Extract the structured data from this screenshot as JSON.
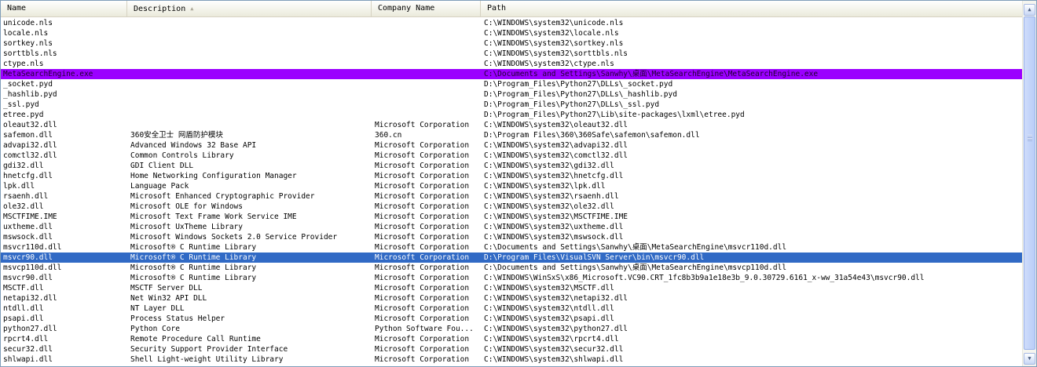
{
  "columns": {
    "name": "Name",
    "description": "Description",
    "company": "Company Name",
    "path": "Path"
  },
  "rows": [
    {
      "name": "unicode.nls",
      "description": "",
      "company": "",
      "path": "C:\\WINDOWS\\system32\\unicode.nls",
      "state": ""
    },
    {
      "name": "locale.nls",
      "description": "",
      "company": "",
      "path": "C:\\WINDOWS\\system32\\locale.nls",
      "state": ""
    },
    {
      "name": "sortkey.nls",
      "description": "",
      "company": "",
      "path": "C:\\WINDOWS\\system32\\sortkey.nls",
      "state": ""
    },
    {
      "name": "sorttbls.nls",
      "description": "",
      "company": "",
      "path": "C:\\WINDOWS\\system32\\sorttbls.nls",
      "state": ""
    },
    {
      "name": "ctype.nls",
      "description": "",
      "company": "",
      "path": "C:\\WINDOWS\\system32\\ctype.nls",
      "state": ""
    },
    {
      "name": "MetaSearchEngine.exe",
      "description": "",
      "company": "",
      "path": "C:\\Documents and Settings\\Sanwhy\\桌面\\MetaSearchEngine\\MetaSearchEngine.exe",
      "state": "purple"
    },
    {
      "name": "_socket.pyd",
      "description": "",
      "company": "",
      "path": "D:\\Program_Files\\Python27\\DLLs\\_socket.pyd",
      "state": ""
    },
    {
      "name": "_hashlib.pyd",
      "description": "",
      "company": "",
      "path": "D:\\Program_Files\\Python27\\DLLs\\_hashlib.pyd",
      "state": ""
    },
    {
      "name": "_ssl.pyd",
      "description": "",
      "company": "",
      "path": "D:\\Program_Files\\Python27\\DLLs\\_ssl.pyd",
      "state": ""
    },
    {
      "name": "etree.pyd",
      "description": "",
      "company": "",
      "path": "D:\\Program_Files\\Python27\\Lib\\site-packages\\lxml\\etree.pyd",
      "state": ""
    },
    {
      "name": "oleaut32.dll",
      "description": "",
      "company": "Microsoft Corporation",
      "path": "C:\\WINDOWS\\system32\\oleaut32.dll",
      "state": ""
    },
    {
      "name": "safemon.dll",
      "description": "360安全卫士 网盾防护模块",
      "company": "360.cn",
      "path": "D:\\Program Files\\360\\360Safe\\safemon\\safemon.dll",
      "state": ""
    },
    {
      "name": "advapi32.dll",
      "description": "Advanced Windows 32 Base API",
      "company": "Microsoft Corporation",
      "path": "C:\\WINDOWS\\system32\\advapi32.dll",
      "state": ""
    },
    {
      "name": "comctl32.dll",
      "description": "Common Controls Library",
      "company": "Microsoft Corporation",
      "path": "C:\\WINDOWS\\system32\\comctl32.dll",
      "state": ""
    },
    {
      "name": "gdi32.dll",
      "description": "GDI Client DLL",
      "company": "Microsoft Corporation",
      "path": "C:\\WINDOWS\\system32\\gdi32.dll",
      "state": ""
    },
    {
      "name": "hnetcfg.dll",
      "description": "Home Networking Configuration Manager",
      "company": "Microsoft Corporation",
      "path": "C:\\WINDOWS\\system32\\hnetcfg.dll",
      "state": ""
    },
    {
      "name": "lpk.dll",
      "description": "Language Pack",
      "company": "Microsoft Corporation",
      "path": "C:\\WINDOWS\\system32\\lpk.dll",
      "state": ""
    },
    {
      "name": "rsaenh.dll",
      "description": "Microsoft Enhanced Cryptographic Provider",
      "company": "Microsoft Corporation",
      "path": "C:\\WINDOWS\\system32\\rsaenh.dll",
      "state": ""
    },
    {
      "name": "ole32.dll",
      "description": "Microsoft OLE for Windows",
      "company": "Microsoft Corporation",
      "path": "C:\\WINDOWS\\system32\\ole32.dll",
      "state": ""
    },
    {
      "name": "MSCTFIME.IME",
      "description": "Microsoft Text Frame Work Service IME",
      "company": "Microsoft Corporation",
      "path": "C:\\WINDOWS\\system32\\MSCTFIME.IME",
      "state": ""
    },
    {
      "name": "uxtheme.dll",
      "description": "Microsoft UxTheme Library",
      "company": "Microsoft Corporation",
      "path": "C:\\WINDOWS\\system32\\uxtheme.dll",
      "state": ""
    },
    {
      "name": "mswsock.dll",
      "description": "Microsoft Windows Sockets 2.0 Service Provider",
      "company": "Microsoft Corporation",
      "path": "C:\\WINDOWS\\system32\\mswsock.dll",
      "state": ""
    },
    {
      "name": "msvcr110d.dll",
      "description": "Microsoft® C Runtime Library",
      "company": "Microsoft Corporation",
      "path": "C:\\Documents and Settings\\Sanwhy\\桌面\\MetaSearchEngine\\msvcr110d.dll",
      "state": ""
    },
    {
      "name": "msvcr90.dll",
      "description": "Microsoft® C Runtime Library",
      "company": "Microsoft Corporation",
      "path": "D:\\Program Files\\VisualSVN Server\\bin\\msvcr90.dll",
      "state": "blue"
    },
    {
      "name": "msvcp110d.dll",
      "description": "Microsoft® C Runtime Library",
      "company": "Microsoft Corporation",
      "path": "C:\\Documents and Settings\\Sanwhy\\桌面\\MetaSearchEngine\\msvcp110d.dll",
      "state": ""
    },
    {
      "name": "msvcr90.dll",
      "description": "Microsoft® C Runtime Library",
      "company": "Microsoft Corporation",
      "path": "C:\\WINDOWS\\WinSxS\\x86_Microsoft.VC90.CRT_1fc8b3b9a1e18e3b_9.0.30729.6161_x-ww_31a54e43\\msvcr90.dll",
      "state": ""
    },
    {
      "name": "MSCTF.dll",
      "description": "MSCTF Server DLL",
      "company": "Microsoft Corporation",
      "path": "C:\\WINDOWS\\system32\\MSCTF.dll",
      "state": ""
    },
    {
      "name": "netapi32.dll",
      "description": "Net Win32 API DLL",
      "company": "Microsoft Corporation",
      "path": "C:\\WINDOWS\\system32\\netapi32.dll",
      "state": ""
    },
    {
      "name": "ntdll.dll",
      "description": "NT Layer DLL",
      "company": "Microsoft Corporation",
      "path": "C:\\WINDOWS\\system32\\ntdll.dll",
      "state": ""
    },
    {
      "name": "psapi.dll",
      "description": "Process Status Helper",
      "company": "Microsoft Corporation",
      "path": "C:\\WINDOWS\\system32\\psapi.dll",
      "state": ""
    },
    {
      "name": "python27.dll",
      "description": "Python Core",
      "company": "Python Software Fou...",
      "path": "C:\\WINDOWS\\system32\\python27.dll",
      "state": ""
    },
    {
      "name": "rpcrt4.dll",
      "description": "Remote Procedure Call Runtime",
      "company": "Microsoft Corporation",
      "path": "C:\\WINDOWS\\system32\\rpcrt4.dll",
      "state": ""
    },
    {
      "name": "secur32.dll",
      "description": "Security Support Provider Interface",
      "company": "Microsoft Corporation",
      "path": "C:\\WINDOWS\\system32\\secur32.dll",
      "state": ""
    },
    {
      "name": "shlwapi.dll",
      "description": "Shell Light-weight Utility Library",
      "company": "Microsoft Corporation",
      "path": "C:\\WINDOWS\\system32\\shlwapi.dll",
      "state": ""
    }
  ],
  "icons": {
    "sort": "sort-ascending-icon",
    "scroll_up": "scroll-up-arrow-icon",
    "scroll_down": "scroll-down-arrow-icon"
  },
  "colors": {
    "selection_purple": "#9b00ff",
    "selection_blue": "#316ac5"
  }
}
